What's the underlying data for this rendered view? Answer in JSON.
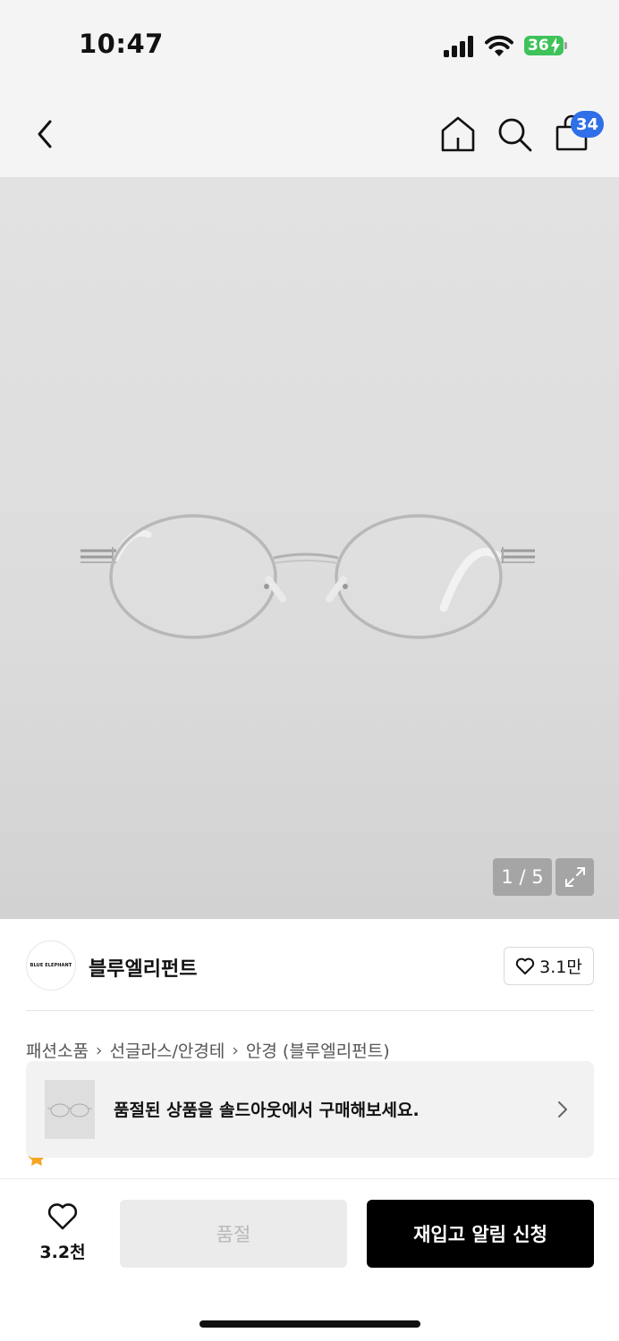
{
  "status_bar": {
    "time": "10:47",
    "battery": "36",
    "icons": [
      "signal-icon",
      "wifi-icon",
      "battery-charging-icon"
    ]
  },
  "nav": {
    "icons": [
      "back-icon",
      "home-icon",
      "search-icon",
      "shopping-bag-icon"
    ],
    "cart_count": "34"
  },
  "product_image": {
    "pager": "1 / 5",
    "expand_icon": "expand-icon"
  },
  "brand": {
    "logo_text": "BLUE ELEPHANT",
    "name": "블루엘리펀트",
    "like_count": "3.1만"
  },
  "breadcrumb": [
    "패션소품",
    "선글라스/안경테",
    "안경 (블루엘리펀트)"
  ],
  "soldout_banner": {
    "text": "품절된 상품을 솔드아웃에서 구매해보세요."
  },
  "bottom_bar": {
    "wish_count": "3.2천",
    "soldout_label": "품절",
    "restock_label": "재입고 알림 신청"
  },
  "colors": {
    "accent_blue": "#2f6fe8",
    "battery_green": "#3ec25a",
    "primary_button": "#000000",
    "disabled_button": "#ebebeb",
    "rating_star": "#f5a623"
  }
}
